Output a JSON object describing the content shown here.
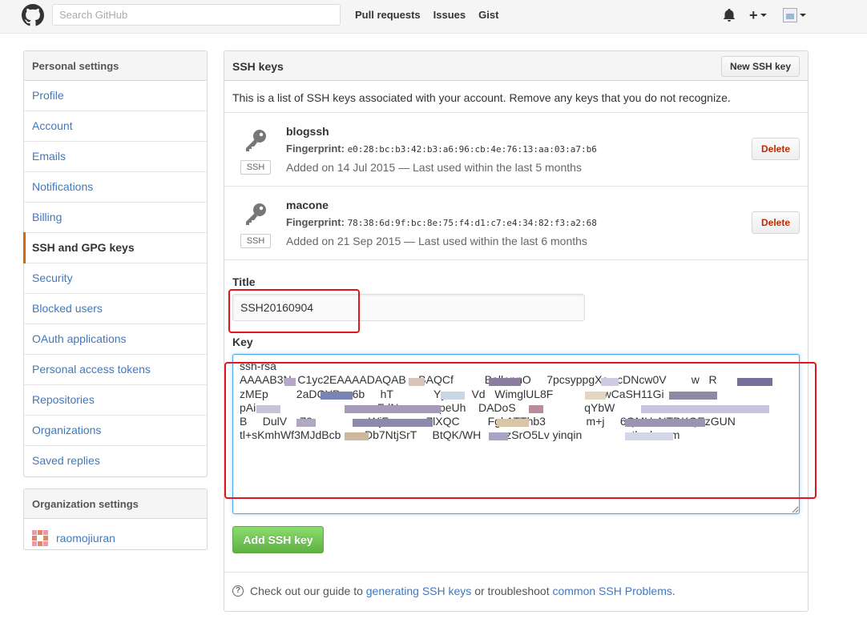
{
  "header": {
    "search_placeholder": "Search GitHub",
    "nav": [
      "Pull requests",
      "Issues",
      "Gist"
    ],
    "plus_label": "+"
  },
  "sidebar": {
    "personal_heading": "Personal settings",
    "items": [
      {
        "label": "Profile",
        "selected": false
      },
      {
        "label": "Account",
        "selected": false
      },
      {
        "label": "Emails",
        "selected": false
      },
      {
        "label": "Notifications",
        "selected": false
      },
      {
        "label": "Billing",
        "selected": false
      },
      {
        "label": "SSH and GPG keys",
        "selected": true
      },
      {
        "label": "Security",
        "selected": false
      },
      {
        "label": "Blocked users",
        "selected": false
      },
      {
        "label": "OAuth applications",
        "selected": false
      },
      {
        "label": "Personal access tokens",
        "selected": false
      },
      {
        "label": "Repositories",
        "selected": false
      },
      {
        "label": "Organizations",
        "selected": false
      },
      {
        "label": "Saved replies",
        "selected": false
      }
    ],
    "org_heading": "Organization settings",
    "org_name": "raomojiuran"
  },
  "main": {
    "title": "SSH keys",
    "new_key_button": "New SSH key",
    "intro": "This is a list of SSH keys associated with your account. Remove any keys that you do not recognize.",
    "keys": [
      {
        "name": "blogssh",
        "badge": "SSH",
        "fingerprint_label": "Fingerprint:",
        "fingerprint": "e0:28:bc:b3:42:b3:a6:96:cb:4e:76:13:aa:03:a7:b6",
        "added": "Added on 14 Jul 2015 — Last used within the last 5 months",
        "delete_label": "Delete"
      },
      {
        "name": "macone",
        "badge": "SSH",
        "fingerprint_label": "Fingerprint:",
        "fingerprint": "78:38:6d:9f:bc:8e:75:f4:d1:c7:e4:34:82:f3:a2:68",
        "added": "Added on 21 Sep 2015 — Last used within the last 6 months",
        "delete_label": "Delete"
      }
    ],
    "form": {
      "title_label": "Title",
      "title_value": "SSH20160904",
      "key_label": "Key",
      "key_value": "ssh-rsa\nAAAAB3N  C1yc2EAAAADAQAB    BAQCf          Ball+pnO     7pcsyppgXc   cDNcw0V        w   R\nzMEp         2aDCYP    6b     hT             Yy        Vd   WimglUL8F                wCaSH11Gi\npAi                                     uFdN             peUh    DADoS                      qYbW\nB     DulV    Z9                  WjF            ZlXQC         Fgb1TThb3             m+j     6QMUzNTDKQEzGUN\ntl+sKmhWf3MJdBcb     wDb7NtjSrT     BtQK/WH     mzSrO5Lv yinqin              utlook.com",
      "add_button": "Add SSH key"
    },
    "footer": {
      "prefix": "Check out our guide to",
      "link1": "generating SSH keys",
      "middle": "or troubleshoot",
      "link2": "common SSH Problems",
      "suffix": "."
    }
  },
  "colors": {
    "link": "#4078c0",
    "selected_bar": "#d26911",
    "delete": "#bd2c00",
    "add_button": "#60b044",
    "annotation": "#e0161c"
  }
}
